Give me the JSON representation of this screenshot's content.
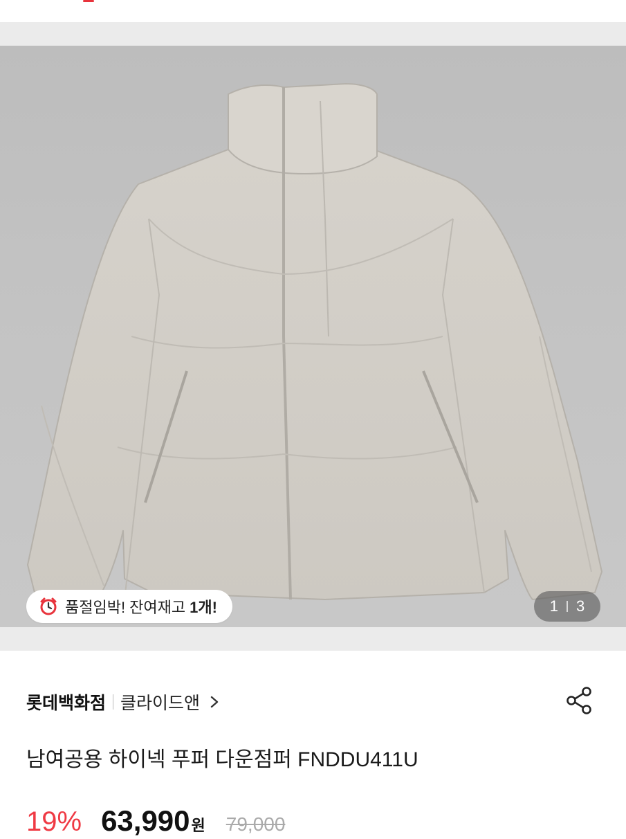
{
  "product_image": {
    "stock_alert": {
      "text": "품절임박! 잔여재고",
      "count": "1개!",
      "icon": "alarm-clock-icon"
    },
    "pager": {
      "current": "1",
      "total": "3"
    }
  },
  "seller": {
    "store": "롯데백화점",
    "brand": "클라이드앤",
    "chevron_icon": "chevron-right-icon",
    "share_icon": "share-icon"
  },
  "product": {
    "title": "남여공용 하이넥 푸퍼 다운점퍼 FNDDU411U"
  },
  "price": {
    "discount": "19%",
    "sale": "63,990",
    "unit": "원",
    "original": "79,000"
  },
  "colors": {
    "accent_red": "#ef3a44",
    "jacket": "#cfcbc4"
  }
}
